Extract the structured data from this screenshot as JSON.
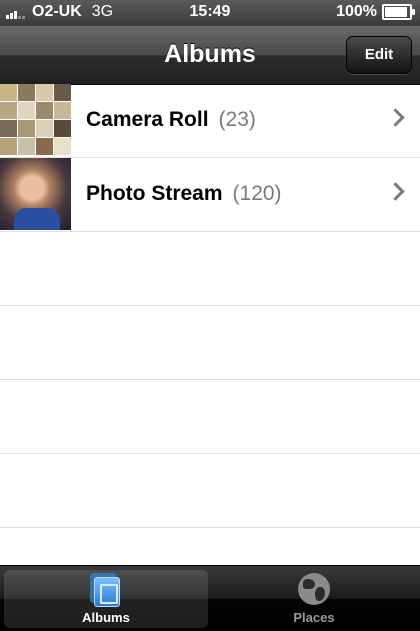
{
  "status_bar": {
    "carrier": "O2-UK",
    "network": "3G",
    "time": "15:49",
    "battery_percent": "100%",
    "battery_level": 1.0
  },
  "nav": {
    "title": "Albums",
    "edit_label": "Edit"
  },
  "albums": [
    {
      "name": "Camera Roll",
      "count": "(23)",
      "thumb": "photo-grid"
    },
    {
      "name": "Photo Stream",
      "count": "(120)",
      "thumb": "child-photo"
    }
  ],
  "tabs": [
    {
      "label": "Albums",
      "icon": "albums-icon",
      "selected": true
    },
    {
      "label": "Places",
      "icon": "globe-icon",
      "selected": false
    }
  ],
  "colors": {
    "tab_selected_icon": "#2f88d8",
    "count_text": "#7a7a7a"
  }
}
